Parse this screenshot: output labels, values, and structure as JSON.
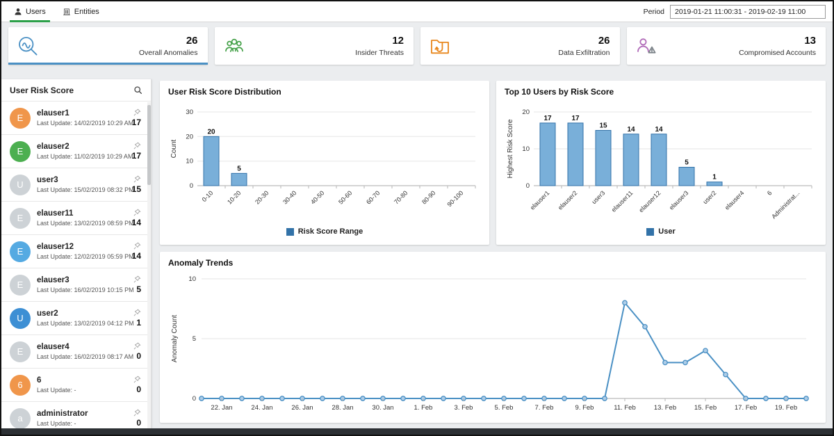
{
  "header": {
    "tabs": [
      {
        "label": "Users",
        "icon": "user-icon",
        "active": true
      },
      {
        "label": "Entities",
        "icon": "building-icon",
        "active": false
      }
    ],
    "period_label": "Period",
    "period_value": "2019-01-21 11:00:31 - 2019-02-19 11:00"
  },
  "summary_cards": [
    {
      "value": "26",
      "label": "Overall Anomalies",
      "icon": "anomaly-search-icon",
      "color": "#4a90c4",
      "active": true
    },
    {
      "value": "12",
      "label": "Insider Threats",
      "icon": "insider-group-icon",
      "color": "#43a047",
      "active": false
    },
    {
      "value": "26",
      "label": "Data Exfiltration",
      "icon": "folder-exfiltration-icon",
      "color": "#e8871e",
      "active": false
    },
    {
      "value": "13",
      "label": "Compromised Accounts",
      "icon": "user-warning-icon",
      "color": "#b06ab8",
      "active": false
    }
  ],
  "sidebar": {
    "title": "User Risk Score",
    "search_icon": "search-icon",
    "users": [
      {
        "name": "elauser1",
        "initial": "E",
        "avatar_color": "#f0964b",
        "last_update": "Last Update: 14/02/2019 10:29 AM",
        "score": "17"
      },
      {
        "name": "elauser2",
        "initial": "E",
        "avatar_color": "#4caf50",
        "last_update": "Last Update: 11/02/2019 10:29 AM",
        "score": "17"
      },
      {
        "name": "user3",
        "initial": "U",
        "avatar_color": "#cdd2d6",
        "last_update": "Last Update: 15/02/2019 08:32 PM",
        "score": "15"
      },
      {
        "name": "elauser11",
        "initial": "E",
        "avatar_color": "#cdd2d6",
        "last_update": "Last Update: 13/02/2019 08:59 PM",
        "score": "14"
      },
      {
        "name": "elauser12",
        "initial": "E",
        "avatar_color": "#55aae2",
        "last_update": "Last Update: 12/02/2019 05:59 PM",
        "score": "14"
      },
      {
        "name": "elauser3",
        "initial": "E",
        "avatar_color": "#cdd2d6",
        "last_update": "Last Update: 16/02/2019 10:15 PM",
        "score": "5"
      },
      {
        "name": "user2",
        "initial": "U",
        "avatar_color": "#3d8fd4",
        "last_update": "Last Update: 13/02/2019 04:12 PM",
        "score": "1"
      },
      {
        "name": "elauser4",
        "initial": "E",
        "avatar_color": "#cdd2d6",
        "last_update": "Last Update: 16/02/2019 08:17 AM",
        "score": "0"
      },
      {
        "name": "6",
        "initial": "6",
        "avatar_color": "#f0964b",
        "last_update": "Last Update: -",
        "score": "0"
      },
      {
        "name": "administrator",
        "initial": "a",
        "avatar_color": "#cdd2d6",
        "last_update": "Last Update: -",
        "score": "0"
      }
    ]
  },
  "chart_data": [
    {
      "type": "bar",
      "title": "User Risk Score Distribution",
      "categories": [
        "0-10",
        "10-20",
        "20-30",
        "30-40",
        "40-50",
        "50-60",
        "60-70",
        "70-80",
        "80-90",
        "90-100"
      ],
      "values": [
        20,
        5,
        0,
        0,
        0,
        0,
        0,
        0,
        0,
        0
      ],
      "xlabel": "",
      "ylabel": "Count",
      "ylim": [
        0,
        30
      ],
      "yticks": [
        0,
        10,
        20,
        30
      ],
      "legend": "Risk Score Range",
      "bar_fill": "#79afd9",
      "bar_border": "#3272a8",
      "grid": true,
      "legend_position": "bottom"
    },
    {
      "type": "bar",
      "title": "Top 10 Users by Risk Score",
      "categories": [
        "elauser1",
        "elauser2",
        "user3",
        "elauser11",
        "elauser12",
        "elauser3",
        "user2",
        "elauser4",
        "6",
        "Administrat..."
      ],
      "values": [
        17,
        17,
        15,
        14,
        14,
        5,
        1,
        0,
        0,
        0
      ],
      "xlabel": "",
      "ylabel": "Highest Risk Score",
      "ylim": [
        0,
        20
      ],
      "yticks": [
        0,
        10,
        20
      ],
      "legend": "User",
      "bar_fill": "#79afd9",
      "bar_border": "#3272a8",
      "grid": true,
      "legend_position": "bottom"
    },
    {
      "type": "line",
      "title": "Anomaly Trends",
      "x": [
        "21. Jan",
        "22. Jan",
        "23. Jan",
        "24. Jan",
        "25. Jan",
        "26. Jan",
        "27. Jan",
        "28. Jan",
        "29. Jan",
        "30. Jan",
        "31. Jan",
        "1. Feb",
        "2. Feb",
        "3. Feb",
        "4. Feb",
        "5. Feb",
        "6. Feb",
        "7. Feb",
        "8. Feb",
        "9. Feb",
        "10. Feb",
        "11. Feb",
        "12. Feb",
        "13. Feb",
        "14. Feb",
        "15. Feb",
        "16. Feb",
        "17. Feb",
        "18. Feb",
        "19. Feb",
        "20. Feb"
      ],
      "values": [
        0,
        0,
        0,
        0,
        0,
        0,
        0,
        0,
        0,
        0,
        0,
        0,
        0,
        0,
        0,
        0,
        0,
        0,
        0,
        0,
        0,
        8,
        6,
        3,
        3,
        4,
        2,
        0,
        0,
        0,
        0
      ],
      "x_ticks": [
        "22. Jan",
        "24. Jan",
        "26. Jan",
        "28. Jan",
        "30. Jan",
        "1. Feb",
        "3. Feb",
        "5. Feb",
        "7. Feb",
        "9. Feb",
        "11. Feb",
        "13. Feb",
        "15. Feb",
        "17. Feb",
        "19. Feb"
      ],
      "xlabel": "",
      "ylabel": "Anomaly Count",
      "ylim": [
        0,
        10
      ],
      "yticks": [
        0,
        5,
        10
      ],
      "line_color": "#4a90c4",
      "marker_fill": "#aecde8",
      "grid": true
    }
  ]
}
